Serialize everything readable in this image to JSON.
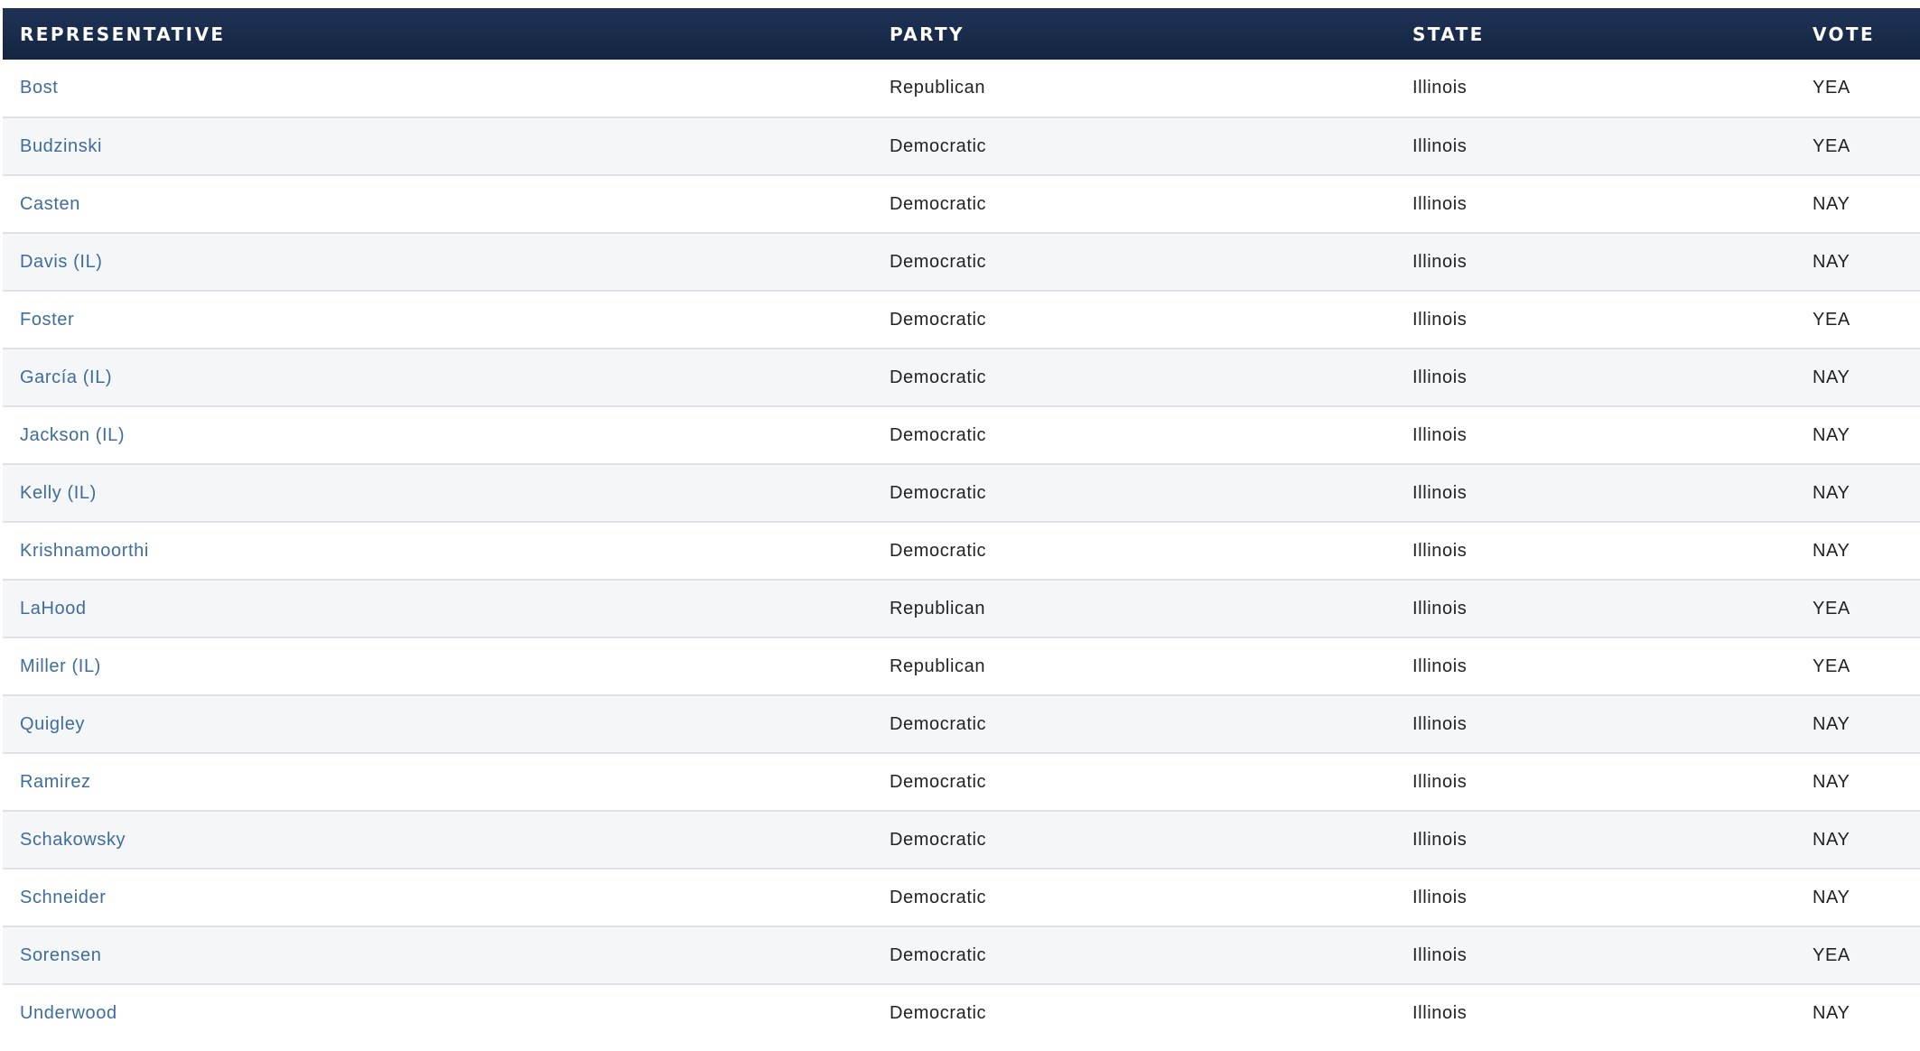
{
  "table": {
    "headers": {
      "representative": "REPRESENTATIVE",
      "party": "PARTY",
      "state": "STATE",
      "vote": "VOTE"
    },
    "rows": [
      {
        "representative": "Bost",
        "party": "Republican",
        "state": "Illinois",
        "vote": "YEA"
      },
      {
        "representative": "Budzinski",
        "party": "Democratic",
        "state": "Illinois",
        "vote": "YEA"
      },
      {
        "representative": "Casten",
        "party": "Democratic",
        "state": "Illinois",
        "vote": "NAY"
      },
      {
        "representative": "Davis (IL)",
        "party": "Democratic",
        "state": "Illinois",
        "vote": "NAY"
      },
      {
        "representative": "Foster",
        "party": "Democratic",
        "state": "Illinois",
        "vote": "YEA"
      },
      {
        "representative": "García (IL)",
        "party": "Democratic",
        "state": "Illinois",
        "vote": "NAY"
      },
      {
        "representative": "Jackson (IL)",
        "party": "Democratic",
        "state": "Illinois",
        "vote": "NAY"
      },
      {
        "representative": "Kelly (IL)",
        "party": "Democratic",
        "state": "Illinois",
        "vote": "NAY"
      },
      {
        "representative": "Krishnamoorthi",
        "party": "Democratic",
        "state": "Illinois",
        "vote": "NAY"
      },
      {
        "representative": "LaHood",
        "party": "Republican",
        "state": "Illinois",
        "vote": "YEA"
      },
      {
        "representative": "Miller (IL)",
        "party": "Republican",
        "state": "Illinois",
        "vote": "YEA"
      },
      {
        "representative": "Quigley",
        "party": "Democratic",
        "state": "Illinois",
        "vote": "NAY"
      },
      {
        "representative": "Ramirez",
        "party": "Democratic",
        "state": "Illinois",
        "vote": "NAY"
      },
      {
        "representative": "Schakowsky",
        "party": "Democratic",
        "state": "Illinois",
        "vote": "NAY"
      },
      {
        "representative": "Schneider",
        "party": "Democratic",
        "state": "Illinois",
        "vote": "NAY"
      },
      {
        "representative": "Sorensen",
        "party": "Democratic",
        "state": "Illinois",
        "vote": "YEA"
      },
      {
        "representative": "Underwood",
        "party": "Democratic",
        "state": "Illinois",
        "vote": "NAY"
      }
    ]
  },
  "colors": {
    "header_background": "#1a2d4f",
    "header_text": "#ffffff",
    "link": "#3d6d9e",
    "row_stripe": "#f5f6f8",
    "row_divider": "#dfe1e6",
    "body_text": "#222222"
  }
}
